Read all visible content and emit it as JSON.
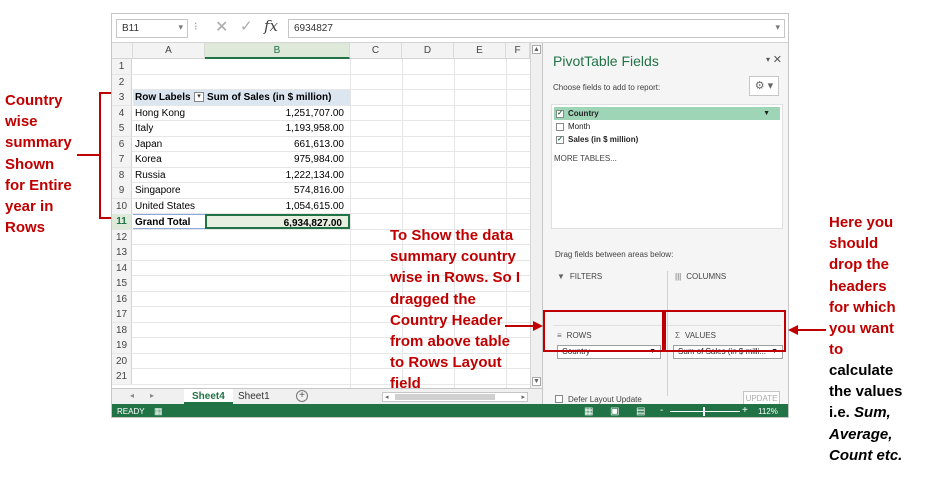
{
  "formula_bar": {
    "name_box": "B11",
    "formula_value": "6934827",
    "fx_label": "fx",
    "cancel_glyph": "✕",
    "enter_glyph": "✓"
  },
  "columns": [
    "A",
    "B",
    "C",
    "D",
    "E",
    "F"
  ],
  "rows": [
    "1",
    "2",
    "3",
    "4",
    "5",
    "6",
    "7",
    "8",
    "9",
    "10",
    "11",
    "12",
    "13",
    "14",
    "15",
    "16",
    "17",
    "18",
    "19",
    "20",
    "21"
  ],
  "pivot_table": {
    "header": {
      "row_labels": "Row Labels",
      "values": "Sum of Sales (in $ million)"
    },
    "items": [
      {
        "label": "Hong Kong",
        "value": "1,251,707.00"
      },
      {
        "label": "Italy",
        "value": "1,193,958.00"
      },
      {
        "label": "Japan",
        "value": "661,613.00"
      },
      {
        "label": "Korea",
        "value": "975,984.00"
      },
      {
        "label": "Russia",
        "value": "1,222,134.00"
      },
      {
        "label": "Singapore",
        "value": "574,816.00"
      },
      {
        "label": "United States",
        "value": "1,054,615.00"
      }
    ],
    "total": {
      "label": "Grand Total",
      "value": "6,934,827.00"
    }
  },
  "sheet_tabs": [
    "Sheet4",
    "Sheet1"
  ],
  "status": {
    "ready": "READY",
    "zoom": "112%",
    "minus": "-",
    "plus": "+"
  },
  "pane": {
    "title": "PivotTable Fields",
    "choose_label": "Choose fields to add to report:",
    "fields": [
      {
        "name": "Country",
        "checked": true
      },
      {
        "name": "Month",
        "checked": false
      },
      {
        "name": "Sales (in $ million)",
        "checked": true
      }
    ],
    "more_tables": "MORE TABLES...",
    "drag_label": "Drag fields between areas below:",
    "areas": {
      "filters": "FILTERS",
      "columns": "COLUMNS",
      "rows": "ROWS",
      "values": "VALUES",
      "rows_field": "Country",
      "values_field": "Sum of Sales (in $ milli..."
    },
    "defer_label": "Defer Layout Update",
    "update_label": "UPDATE"
  },
  "annotations": {
    "left": "Country\nwise\nsummary\nShown\nfor Entire\nyear in\nRows",
    "middle": "To Show the data\nsummary country\nwise in Rows. So I\ndragged the\nCountry Header\nfrom above table\nto Rows Layout\nfield",
    "right_red": "Here you\nshould\ndrop the\nheaders\nfor which\nyou want\nto",
    "right_black_1": "calculate\nthe values\ni.e.",
    "right_black_2": "Sum,\nAverage,\nCount etc."
  },
  "colors": {
    "excel_green": "#217346",
    "annotation_red": "#c00000",
    "pivot_header_blue": "#dce6f1",
    "field_highlight": "#9fd5b7"
  }
}
